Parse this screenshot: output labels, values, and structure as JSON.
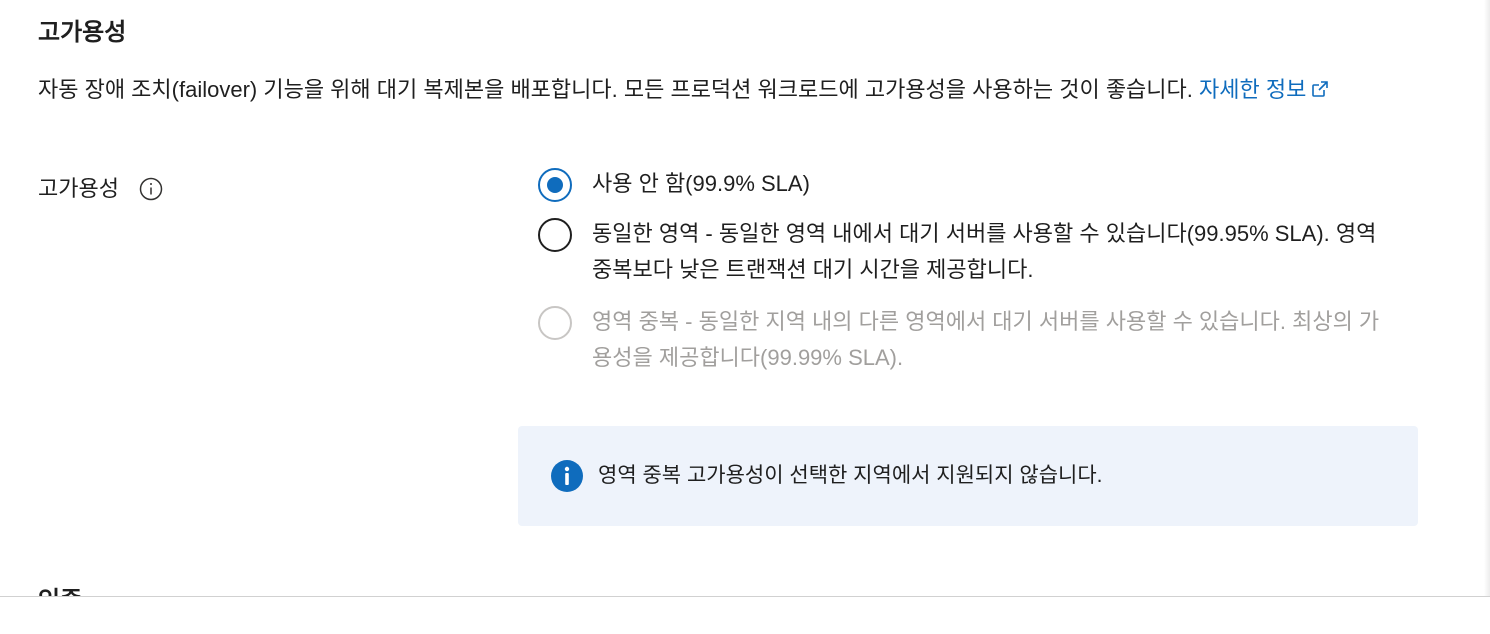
{
  "section": {
    "title": "고가용성",
    "description": "자동 장애 조치(failover) 기능을 위해 대기 복제본을 배포합니다. 모든 프로덕션 워크로드에 고가용성을 사용하는 것이 좋습니다.",
    "learn_more": "자세한 정보"
  },
  "field": {
    "label": "고가용성",
    "options": [
      {
        "label": "사용 안 함(99.9% SLA)",
        "selected": true,
        "disabled": false
      },
      {
        "label": "동일한 영역 - 동일한 영역 내에서 대기 서버를 사용할 수 있습니다(99.95% SLA). 영역 중복보다 낮은 트랜잭션 대기 시간을 제공합니다.",
        "selected": false,
        "disabled": false
      },
      {
        "label": "영역 중복 - 동일한 지역 내의 다른 영역에서 대기 서버를 사용할 수 있습니다. 최상의 가용성을 제공합니다(99.99% SLA).",
        "selected": false,
        "disabled": true
      }
    ]
  },
  "info_bar": {
    "message": "영역 중복 고가용성이 선택한 지역에서 지원되지 않습니다."
  },
  "next_section": {
    "title": "인증"
  },
  "icons": {
    "external_link": "external-link-icon",
    "info_tooltip": "info-circle-icon",
    "info_bar": "info-filled-icon"
  },
  "colors": {
    "accent": "#0f6cbd",
    "info_bar_bg": "#eef3fb",
    "disabled_text": "#a19f9d"
  }
}
